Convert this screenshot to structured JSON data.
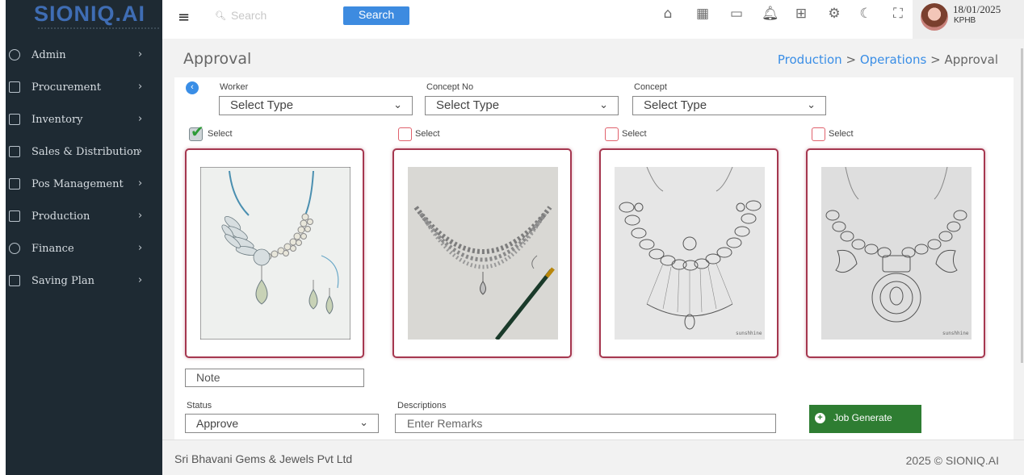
{
  "brand": {
    "logo": "SIONIQ.AI"
  },
  "sidebar": {
    "items": [
      {
        "label": "Admin",
        "icon": "users-icon"
      },
      {
        "label": "Procurement",
        "icon": "grid-icon"
      },
      {
        "label": "Inventory",
        "icon": "upload-box-icon"
      },
      {
        "label": "Sales & Distribution",
        "icon": "monitor-icon"
      },
      {
        "label": "Pos Management",
        "icon": "frame-icon"
      },
      {
        "label": "Production",
        "icon": "columns-icon"
      },
      {
        "label": "Finance",
        "icon": "gear-flower-icon"
      },
      {
        "label": "Saving Plan",
        "icon": "list-box-icon"
      }
    ]
  },
  "header": {
    "search_placeholder": "Search",
    "search_button": "Search",
    "icons": [
      "home-icon",
      "apps-icon",
      "ticket-icon",
      "bell-icon",
      "grid-icon",
      "settings-icon",
      "moon-icon",
      "fullscreen-icon"
    ],
    "user": {
      "date": "18/01/2025",
      "name": "KPHB"
    }
  },
  "page": {
    "title": "Approval",
    "breadcrumb": [
      {
        "label": "Production",
        "link": true
      },
      {
        "label": ">",
        "link": false
      },
      {
        "label": "Operations",
        "link": true
      },
      {
        "label": ">",
        "link": false
      },
      {
        "label": "Approval",
        "link": false
      }
    ]
  },
  "filters": {
    "worker": {
      "label": "Worker",
      "value": "Select Type"
    },
    "concept_no": {
      "label": "Concept No",
      "value": "Select Type"
    },
    "concept": {
      "label": "Concept",
      "value": "Select Type"
    }
  },
  "designs": [
    {
      "select_label": "Select",
      "checked": true
    },
    {
      "select_label": "Select",
      "checked": false
    },
    {
      "select_label": "Select",
      "checked": false
    },
    {
      "select_label": "Select",
      "checked": false
    }
  ],
  "form": {
    "note_placeholder": "Note",
    "status_label": "Status",
    "status_value": "Approve",
    "descriptions_label": "Descriptions",
    "descriptions_placeholder": "Enter Remarks",
    "job_button": "Job Generate"
  },
  "footer": {
    "company": "Sri Bhavani Gems & Jewels Pvt Ltd",
    "copyright": "2025 © SIONIQ.AI"
  }
}
